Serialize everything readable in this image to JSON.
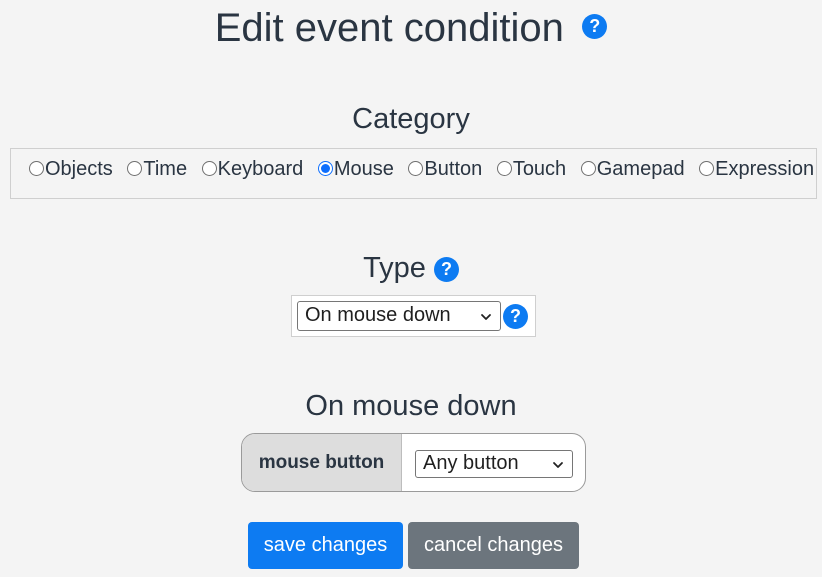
{
  "dialog": {
    "title": "Edit event condition",
    "help_icon": "?"
  },
  "category": {
    "heading": "Category",
    "selected": "Mouse",
    "options": [
      {
        "label": "Objects",
        "checked": false
      },
      {
        "label": "Time",
        "checked": false
      },
      {
        "label": "Keyboard",
        "checked": false
      },
      {
        "label": "Mouse",
        "checked": true
      },
      {
        "label": "Button",
        "checked": false
      },
      {
        "label": "Touch",
        "checked": false
      },
      {
        "label": "Gamepad",
        "checked": false
      },
      {
        "label": "Expression",
        "checked": false
      }
    ]
  },
  "type": {
    "heading": "Type",
    "help_icon": "?",
    "selected_value": "On mouse down",
    "select_help_icon": "?"
  },
  "condition": {
    "heading": "On mouse down",
    "param_label": "mouse button",
    "param_value": "Any button"
  },
  "actions": {
    "save_label": "save changes",
    "cancel_label": "cancel changes"
  },
  "colors": {
    "primary": "#0d7bf2",
    "secondary": "#6c757d",
    "text": "#2a3542",
    "background": "#f4f4f4"
  },
  "icons": [
    "question-circle-icon",
    "chevron-down-icon",
    "radio-icon"
  ]
}
